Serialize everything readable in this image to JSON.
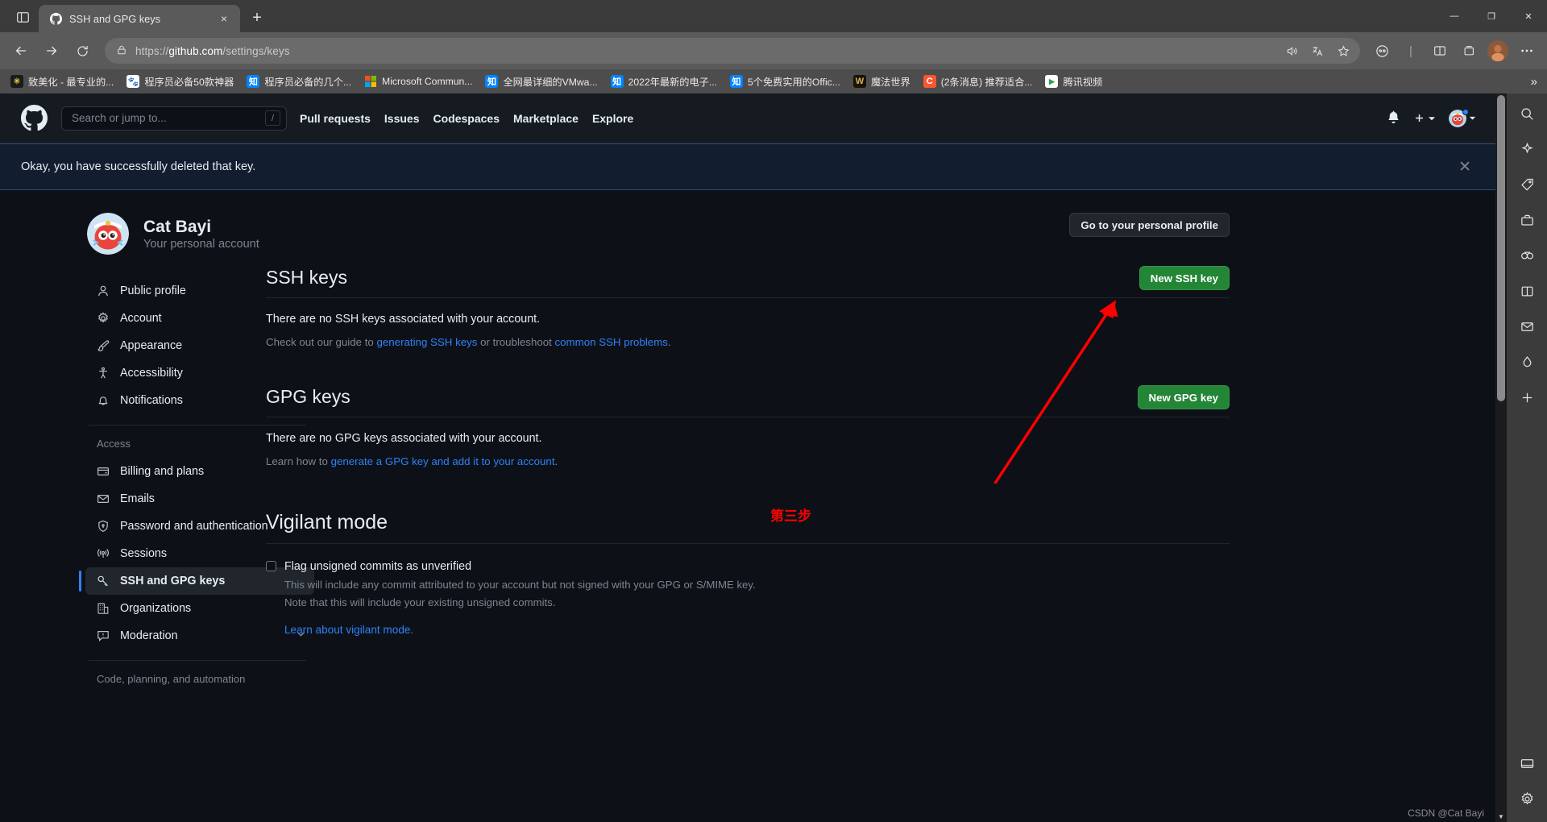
{
  "browser": {
    "tab": {
      "title": "SSH and GPG keys",
      "favicon": "github-icon",
      "close_label": "×"
    },
    "new_tab_label": "+",
    "window_controls": {
      "minimize": "—",
      "maximize": "❐",
      "close": "✕"
    },
    "nav": {
      "back": "←",
      "forward": "→",
      "reload": "↻"
    },
    "omnibox": {
      "url_prefix": "https://",
      "url_host": "github.com",
      "url_path": "/settings/keys",
      "full_url": "https://github.com/settings/keys",
      "lock_icon": "lock-icon",
      "icons": [
        "read-aloud-icon",
        "translate-icon",
        "favorite-star-icon"
      ]
    },
    "toolbar_right": [
      "collections-icon",
      "split-screen-icon",
      "browser-essentials-icon",
      "profile-avatar"
    ],
    "bookmarks": [
      {
        "label": "致美化 - 最专业的...",
        "icon_text": "✸",
        "icon_bg": "#1b1b1b",
        "icon_color": "#e8c547"
      },
      {
        "label": "程序员必备50款神器",
        "icon_text": "熊",
        "icon_bg": "#ffffff",
        "icon_color": "#2229dd"
      },
      {
        "label": "程序员必备的几个...",
        "icon_text": "知",
        "icon_bg": "#0084ff",
        "icon_color": "#ffffff"
      },
      {
        "label": "Microsoft Commun...",
        "icon_text": "",
        "icon_bg": "transparent",
        "icon_color": "#ffffff"
      },
      {
        "label": "全网最详细的VMwa...",
        "icon_text": "知",
        "icon_bg": "#0084ff",
        "icon_color": "#ffffff"
      },
      {
        "label": "2022年最新的电子...",
        "icon_text": "知",
        "icon_bg": "#0084ff",
        "icon_color": "#ffffff"
      },
      {
        "label": "5个免费实用的Offic...",
        "icon_text": "知",
        "icon_bg": "#0084ff",
        "icon_color": "#ffffff"
      },
      {
        "label": "魔法世界",
        "icon_text": "W",
        "icon_bg": "#1a1408",
        "icon_color": "#d7b55a"
      },
      {
        "label": "(2条消息) 推荐适合...",
        "icon_text": "C",
        "icon_bg": "#fc5531",
        "icon_color": "#ffffff"
      },
      {
        "label": "腾讯视频",
        "icon_text": "▶",
        "icon_bg": "#ffffff",
        "icon_color": "#2ba24c"
      }
    ],
    "bookmarks_overflow": "»",
    "edge_sidebar": [
      "search-icon",
      "copilot-icon",
      "shopping-tag-icon",
      "tools-icon",
      "games-icon",
      "split-icon",
      "outlook-icon",
      "drop-icon",
      "add-tool-icon",
      "screenshot-icon",
      "settings-gear-icon"
    ]
  },
  "github": {
    "header": {
      "logo": "github-mark-icon",
      "search_placeholder": "Search or jump to...",
      "search_shortcut": "/",
      "nav": [
        "Pull requests",
        "Issues",
        "Codespaces",
        "Marketplace",
        "Explore"
      ],
      "notifications_icon": "bell-icon",
      "create_new_icon": "plus-icon",
      "account_icon": "avatar-icon"
    },
    "flash": {
      "message": "Okay, you have successfully deleted that key.",
      "dismiss": "✕"
    },
    "profile": {
      "name": "Cat Bayi",
      "subtitle": "Your personal account",
      "avatar": "user-avatar"
    },
    "sidebar": {
      "items": [
        {
          "label": "Public profile",
          "icon": "person-icon"
        },
        {
          "label": "Account",
          "icon": "gear-icon"
        },
        {
          "label": "Appearance",
          "icon": "paintbrush-icon"
        },
        {
          "label": "Accessibility",
          "icon": "accessibility-icon"
        },
        {
          "label": "Notifications",
          "icon": "bell-icon"
        }
      ],
      "group_access_title": "Access",
      "access_items": [
        {
          "label": "Billing and plans",
          "icon": "credit-card-icon"
        },
        {
          "label": "Emails",
          "icon": "mail-icon"
        },
        {
          "label": "Password and authentication",
          "icon": "shield-lock-icon"
        },
        {
          "label": "Sessions",
          "icon": "broadcast-icon"
        },
        {
          "label": "SSH and GPG keys",
          "icon": "key-icon",
          "active": true
        },
        {
          "label": "Organizations",
          "icon": "organization-icon"
        },
        {
          "label": "Moderation",
          "icon": "report-icon",
          "expandable": true,
          "chevron": "chevron-down-icon"
        }
      ],
      "group_code_title": "Code, planning, and automation"
    },
    "main": {
      "personal_profile_button": "Go to your personal profile",
      "ssh": {
        "title": "SSH keys",
        "button": "New SSH key",
        "empty_text": "There are no SSH keys associated with your account.",
        "help_prefix": "Check out our guide to ",
        "help_link_1": "generating SSH keys",
        "help_middle": " or troubleshoot ",
        "help_link_2": "common SSH problems",
        "help_suffix": "."
      },
      "gpg": {
        "title": "GPG keys",
        "button": "New GPG key",
        "empty_text": "There are no GPG keys associated with your account.",
        "help_prefix": "Learn how to ",
        "help_link_1": "generate a GPG key and add it to your account",
        "help_suffix": "."
      },
      "vigilant": {
        "title": "Vigilant mode",
        "checkbox_label": "Flag unsigned commits as unverified",
        "desc_line_1": "This will include any commit attributed to your account but not signed with your GPG or S/MIME key.",
        "desc_line_2": "Note that this will include your existing unsigned commits.",
        "learn_link": "Learn about vigilant mode."
      }
    }
  },
  "annotations": {
    "step_label": "第三步",
    "arrow_color": "#ff0000",
    "watermark": "CSDN @Cat Bayi"
  }
}
